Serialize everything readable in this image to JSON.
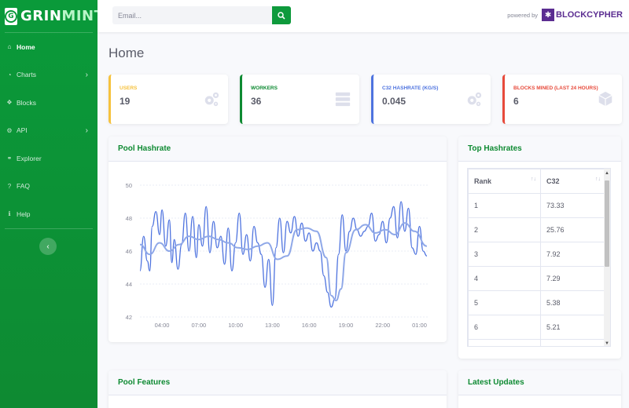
{
  "brand": {
    "part1": "GRIN",
    "part2": "MINT"
  },
  "sidebar": {
    "items": [
      {
        "label": "Home",
        "icon": "home-icon",
        "active": true,
        "chevron": false
      },
      {
        "label": "Charts",
        "icon": "chart-icon",
        "active": false,
        "chevron": true
      },
      {
        "label": "Blocks",
        "icon": "cubes-icon",
        "active": false,
        "chevron": false
      },
      {
        "label": "API",
        "icon": "gear-icon",
        "active": false,
        "chevron": true
      },
      {
        "label": "Explorer",
        "icon": "binoculars-icon",
        "active": false,
        "chevron": false
      },
      {
        "label": "FAQ",
        "icon": "question-icon",
        "active": false,
        "chevron": false
      },
      {
        "label": "Help",
        "icon": "info-icon",
        "active": false,
        "chevron": false
      }
    ],
    "toggle_glyph": "‹"
  },
  "topbar": {
    "search_placeholder": "Email...",
    "powered_by": "powered by",
    "partner": "BLOCKCYPHER"
  },
  "page_title": "Home",
  "stats": [
    {
      "label": "USERS",
      "value": "19",
      "color": "#f6c23e",
      "label_color": "#f6c23e",
      "icon": "cogs-icon"
    },
    {
      "label": "WORKERS",
      "value": "36",
      "color": "#0e8a32",
      "label_color": "#0e8a32",
      "icon": "server-icon"
    },
    {
      "label": "C32 HASHRATE (KG/S)",
      "value": "0.045",
      "color": "#4e73df",
      "label_color": "#4e73df",
      "icon": "cogs-icon"
    },
    {
      "label": "BLOCKS MINED (LAST 24 HOURS)",
      "value": "6",
      "color": "#e74a3b",
      "label_color": "#e74a3b",
      "icon": "cube-icon"
    }
  ],
  "pool_hashrate": {
    "title": "Pool Hashrate"
  },
  "top_hashrates": {
    "title": "Top Hashrates",
    "columns": [
      "Rank",
      "C32"
    ],
    "rows": [
      [
        "1",
        "73.33"
      ],
      [
        "2",
        "25.76"
      ],
      [
        "3",
        "7.92"
      ],
      [
        "4",
        "7.29"
      ],
      [
        "5",
        "5.38"
      ],
      [
        "6",
        "5.21"
      ],
      [
        "",
        ""
      ]
    ]
  },
  "pool_features": {
    "title": "Pool Features"
  },
  "latest_updates": {
    "title": "Latest Updates"
  },
  "chart_data": {
    "type": "line",
    "title": "",
    "xlabel": "",
    "ylabel": "",
    "ylim": [
      42,
      50
    ],
    "yticks": [
      42,
      44,
      46,
      48,
      50
    ],
    "xticks": [
      "04:00",
      "07:00",
      "10:00",
      "13:00",
      "16:00",
      "19:00",
      "22:00",
      "01:00"
    ],
    "xlim": [
      2.2,
      25.8
    ],
    "grid": true,
    "colors": [
      "#4e73df",
      "#8fa8e8"
    ],
    "series": [
      {
        "x": [
          2.2,
          2.5,
          2.8,
          3.0,
          3.2,
          3.5,
          3.8,
          4.0,
          4.3,
          4.6,
          4.8,
          5.0,
          5.3,
          5.6,
          5.9,
          6.2,
          6.5,
          6.8,
          7.0,
          7.3,
          7.6,
          7.9,
          8.2,
          8.5,
          8.8,
          9.1,
          9.4,
          9.7,
          10.0,
          10.3,
          10.6,
          10.9,
          11.2,
          11.5,
          11.8,
          12.1,
          12.4,
          12.7,
          13.0,
          13.3,
          13.6,
          13.9,
          14.2,
          14.5,
          14.8,
          15.1,
          15.4,
          15.7,
          16.0,
          16.3,
          16.6,
          16.9,
          17.2,
          17.5,
          17.8,
          18.1,
          18.4,
          18.7,
          19.0,
          19.3,
          19.6,
          19.9,
          20.2,
          20.5,
          20.8,
          21.1,
          21.4,
          21.7,
          22.0,
          22.3,
          22.6,
          22.9,
          23.2,
          23.5,
          23.8,
          24.1,
          24.4,
          24.7,
          25.0,
          25.3,
          25.6
        ],
        "values": [
          44.8,
          46.9,
          45.4,
          44.8,
          47.5,
          48.4,
          47.0,
          48.5,
          46.3,
          47.9,
          45.3,
          46.7,
          44.9,
          46.4,
          48.3,
          46.0,
          48.1,
          45.6,
          47.6,
          46.3,
          48.7,
          45.9,
          47.8,
          46.2,
          46.9,
          45.2,
          47.4,
          44.8,
          46.5,
          48.3,
          45.8,
          47.0,
          45.4,
          47.5,
          46.5,
          45.8,
          43.8,
          45.5,
          42.7,
          46.2,
          48.0,
          45.9,
          47.8,
          47.1,
          48.1,
          46.9,
          47.7,
          46.6,
          47.1,
          46.0,
          46.5,
          46.0,
          44.5,
          43.5,
          42.6,
          43.1,
          45.8,
          48.2,
          46.0,
          47.2,
          48.0,
          47.3,
          46.9,
          47.2,
          47.5,
          48.3,
          46.6,
          47.0,
          47.8,
          46.5,
          48.0,
          48.7,
          46.8,
          49.0,
          47.2,
          48.6,
          46.2,
          45.8,
          47.5,
          46.0,
          45.7
        ]
      },
      {
        "x": [
          2.2,
          3.0,
          3.8,
          4.6,
          5.4,
          6.2,
          7.0,
          7.8,
          8.6,
          9.4,
          10.2,
          11.0,
          11.8,
          12.6,
          13.4,
          14.2,
          15.0,
          15.8,
          16.6,
          17.4,
          17.8,
          18.2,
          18.6,
          19.0,
          19.8,
          20.6,
          21.4,
          22.2,
          23.0,
          23.8,
          24.6,
          25.6
        ],
        "values": [
          46.4,
          45.8,
          46.5,
          46.0,
          46.4,
          46.9,
          46.7,
          46.9,
          46.7,
          46.5,
          46.2,
          46.1,
          46.3,
          46.5,
          45.5,
          45.7,
          47.3,
          47.4,
          47.2,
          45.6,
          43.3,
          43.0,
          43.7,
          45.9,
          47.3,
          47.6,
          47.1,
          47.3,
          47.0,
          47.7,
          47.2,
          46.3
        ]
      }
    ]
  }
}
